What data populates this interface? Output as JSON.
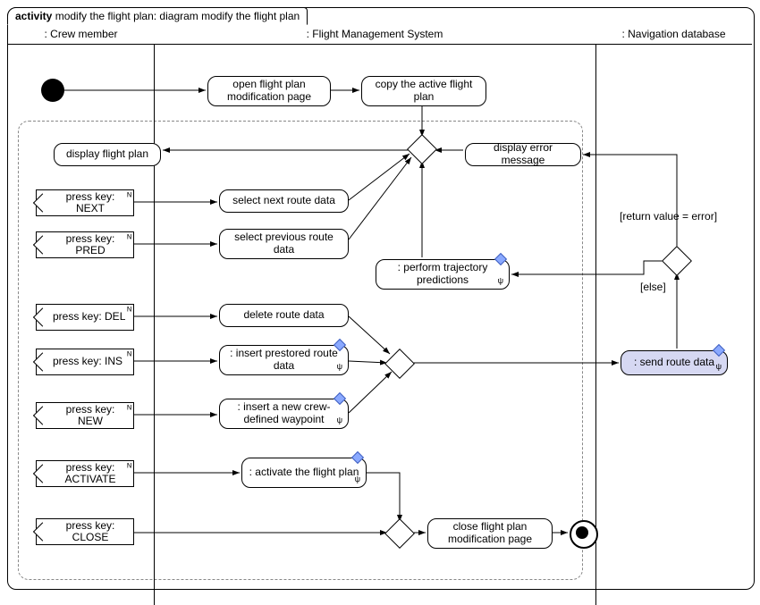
{
  "frame": {
    "kind": "activity",
    "title": "modify the flight plan: diagram modify the flight plan"
  },
  "lanes": {
    "crew": ": Crew member",
    "fms": ": Flight Management System",
    "nav": ": Navigation database"
  },
  "nodes": {
    "open_page": "open flight plan modification page",
    "copy_plan": "copy the active flight plan",
    "display": "display flight plan",
    "err_msg": "display error message",
    "sel_next": "select next route data",
    "sel_prev": "select previous route data",
    "perf_traj": ": perform trajectory predictions",
    "del_route": "delete route data",
    "ins_pre": ": insert prestored route data",
    "ins_wp": ": insert a new crew-defined waypoint",
    "activate": ": activate the flight plan",
    "send_route": ": send route data",
    "close_page": "close flight plan modification page"
  },
  "events": {
    "next": "press key: NEXT",
    "pred": "press key: PRED",
    "del": "press key: DEL",
    "ins": "press key: INS",
    "new": "press key: NEW",
    "act": "press key: ACTIVATE",
    "close": "press key: CLOSE"
  },
  "guards": {
    "err": "[return value = error]",
    "else": "[else]"
  },
  "icons": {
    "rake": "♆",
    "zig": "ᴺ"
  }
}
